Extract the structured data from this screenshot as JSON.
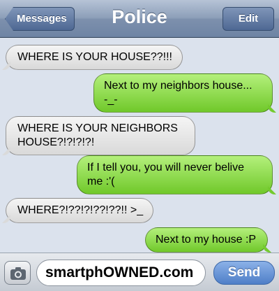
{
  "header": {
    "back_label": "Messages",
    "title": "Police",
    "edit_label": "Edit"
  },
  "messages": [
    {
      "side": "in",
      "text": "WHERE IS YOUR HOUSE??!!!"
    },
    {
      "side": "out",
      "line1": "Next to my neighbors house...",
      "line2": "-_-"
    },
    {
      "side": "in",
      "line1": "WHERE IS YOUR NEIGHBORS",
      "line2": "HOUSE?!?!?!?!"
    },
    {
      "side": "out",
      "line1": "If I tell you, you will never belive",
      "line2": "me :'("
    },
    {
      "side": "in",
      "text": "WHERE?!??!?!??!??!! >_"
    },
    {
      "side": "out",
      "text": "Next to my house :P"
    }
  ],
  "composer": {
    "field_text": "smartphOWNED.com",
    "send_label": "Send",
    "camera_icon": "camera-icon"
  },
  "colors": {
    "incoming": "#e6e6e6",
    "outgoing": "#8ed84c",
    "background": "#dbe2ed",
    "send": "#5a88cf"
  }
}
